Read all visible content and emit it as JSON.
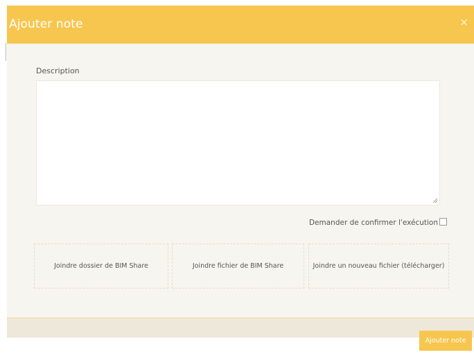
{
  "dialog": {
    "title": "Ajouter note",
    "close_symbol": "×",
    "close_icon": "close-icon"
  },
  "form": {
    "description_label": "Description",
    "description_value": "",
    "confirm_label": "Demander de confirmer l'exécution",
    "confirm_checked": false
  },
  "attachments": [
    {
      "label": "Joindre dossier de BIM Share"
    },
    {
      "label": "Joindre fichier de BIM Share"
    },
    {
      "label": "Joindre un nouveau fichier (télécharger)"
    }
  ],
  "footer": {
    "submit_label": "Ajouter note"
  },
  "colors": {
    "accent": "#f7c64f",
    "body_bg": "#f7f5ef",
    "footer_bg": "#ede8da"
  }
}
